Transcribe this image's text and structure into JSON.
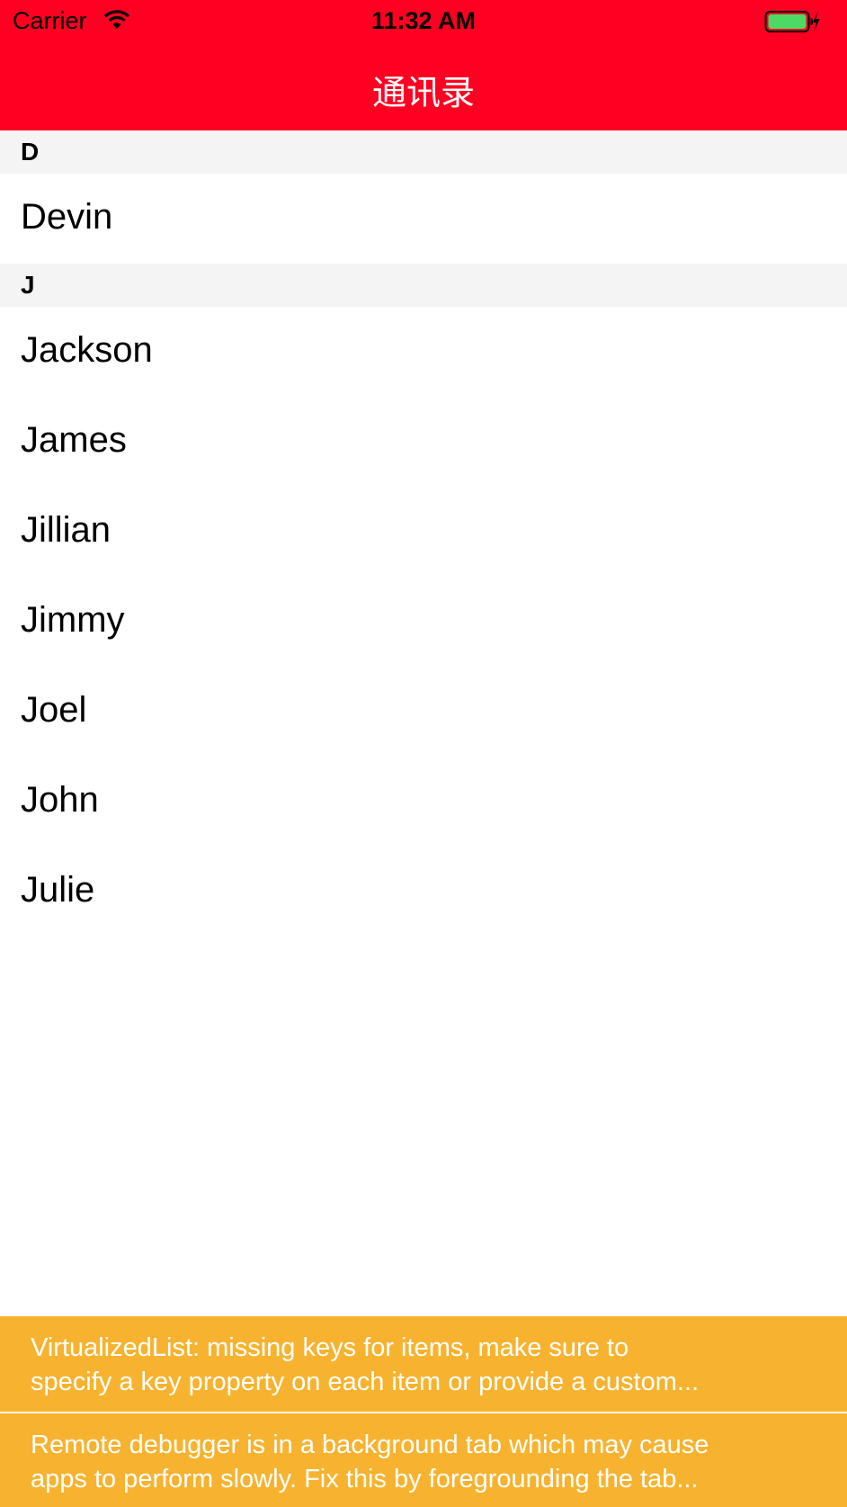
{
  "status_bar": {
    "carrier": "Carrier",
    "time": "11:32 AM"
  },
  "nav": {
    "title": "通讯录"
  },
  "sections": [
    {
      "letter": "D",
      "contacts": [
        "Devin"
      ]
    },
    {
      "letter": "J",
      "contacts": [
        "Jackson",
        "James",
        "Jillian",
        "Jimmy",
        "Joel",
        "John",
        "Julie"
      ]
    }
  ],
  "warnings": [
    {
      "line1": "VirtualizedList: missing keys for items, make sure to",
      "line2": "specify a key property on each item or provide a custom..."
    },
    {
      "line1": "Remote debugger is in a background tab which may cause",
      "line2": "apps to perform slowly. Fix this by foregrounding the tab..."
    }
  ],
  "colors": {
    "nav_background": "#ff0022",
    "section_background": "#f4f4f4",
    "warning_background": "#f7b32f",
    "battery_fill": "#4cd964"
  },
  "icons": {
    "wifi": "wifi-icon",
    "battery": "battery-charging-icon"
  }
}
